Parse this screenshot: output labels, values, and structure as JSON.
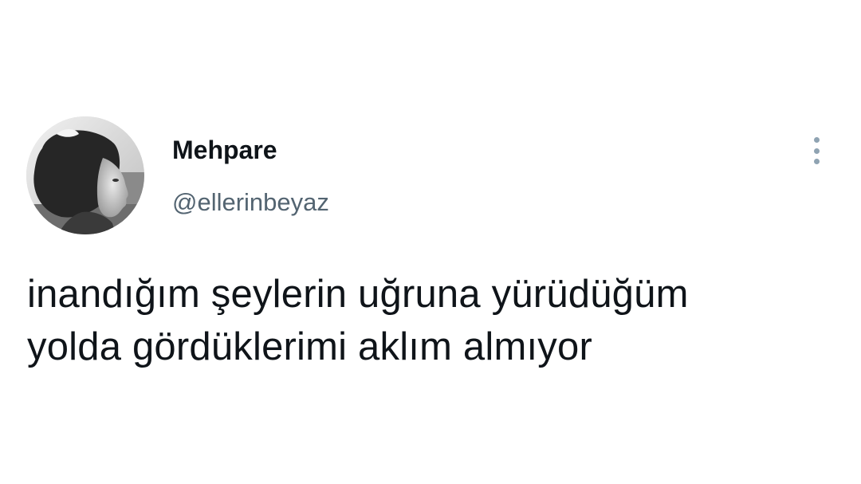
{
  "tweet": {
    "author": {
      "display_name": "Mehpare",
      "handle": "@ellerinbeyaz",
      "avatar_icon": "profile-photo"
    },
    "text_lines": [
      "inandığım şeylerin uğruna yürüdüğüm",
      "yolda gördüklerimi aklım almıyor"
    ],
    "more_icon": "more-vertical-icon"
  },
  "colors": {
    "background": "#ffffff",
    "text_primary": "#0f1419",
    "text_secondary": "#536471",
    "more_icon": "#8fa3b2"
  }
}
